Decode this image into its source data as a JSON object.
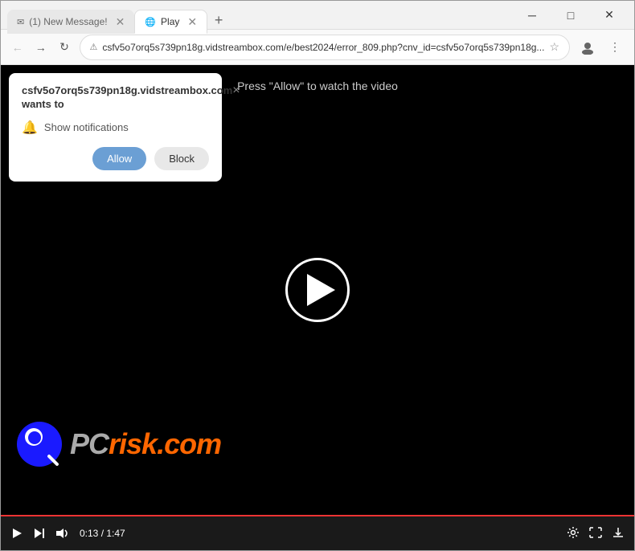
{
  "window": {
    "title": "Play"
  },
  "tabs": [
    {
      "id": "tab-email",
      "label": "(1) New Message!",
      "icon": "✉",
      "active": false
    },
    {
      "id": "tab-play",
      "label": "Play",
      "icon": "🌐",
      "active": true
    }
  ],
  "controls": {
    "new_tab": "+",
    "minimize": "─",
    "maximize": "□",
    "close": "✕"
  },
  "addressbar": {
    "back": "←",
    "forward": "→",
    "refresh": "↻",
    "url": "csfv5o7orq5s739pn18g.vidstreambox.com/e/best2024/error_809.php?cnv_id=csfv5o7orq5s739pn18g...",
    "star": "☆"
  },
  "toolbar": {
    "profile_icon": "👤",
    "menu_icon": "⋮"
  },
  "popup": {
    "title": "csfv5o7orq5s739pn18g.vidstreambox.com wants to",
    "close_btn": "×",
    "notification_label": "Show notifications",
    "allow_btn": "Allow",
    "block_btn": "Block"
  },
  "video": {
    "press_allow_text": "Press \"Allow\" to watch the video",
    "time_current": "0:13",
    "time_total": "1:47",
    "pcrisk_brand": "risk.com",
    "pcrisk_prefix": "PC"
  }
}
